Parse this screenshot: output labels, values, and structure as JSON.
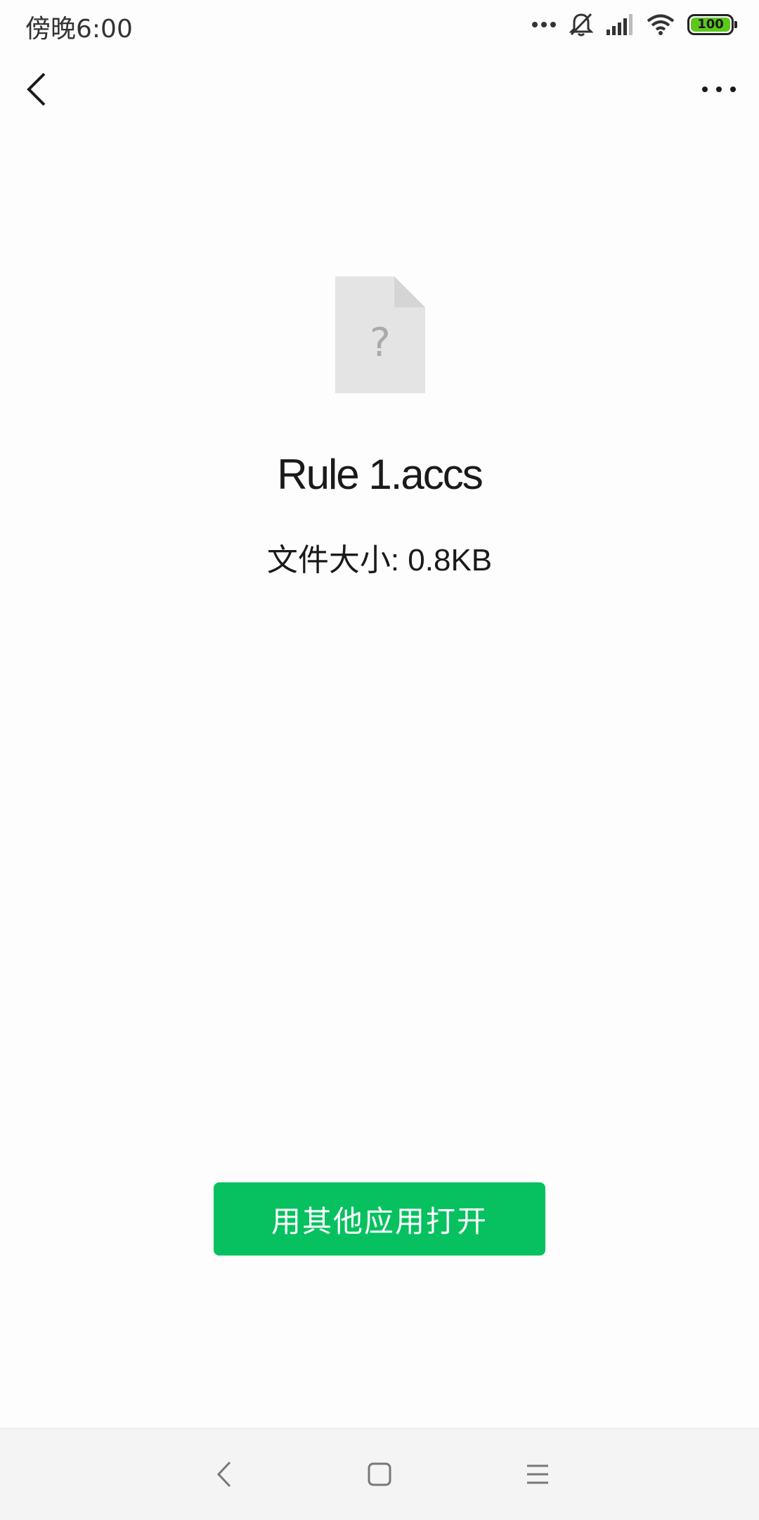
{
  "status_bar": {
    "time": "傍晚6:00",
    "battery": "100",
    "icons": [
      "more-dots-icon",
      "silent-bell-icon",
      "signal-icon",
      "wifi-icon",
      "battery-icon"
    ]
  },
  "top_bar": {
    "back_icon": "chevron-left-icon",
    "more_icon": "more-horizontal-icon"
  },
  "file": {
    "icon": "unknown-file-icon",
    "icon_glyph": "?",
    "name": "Rule 1.accs",
    "size_label": "文件大小: 0.8KB"
  },
  "actions": {
    "open_with_label": "用其他应用打开",
    "button_color": "#07c160"
  },
  "nav_bar": {
    "icons": [
      "nav-back-icon",
      "nav-home-icon",
      "nav-menu-icon"
    ]
  }
}
